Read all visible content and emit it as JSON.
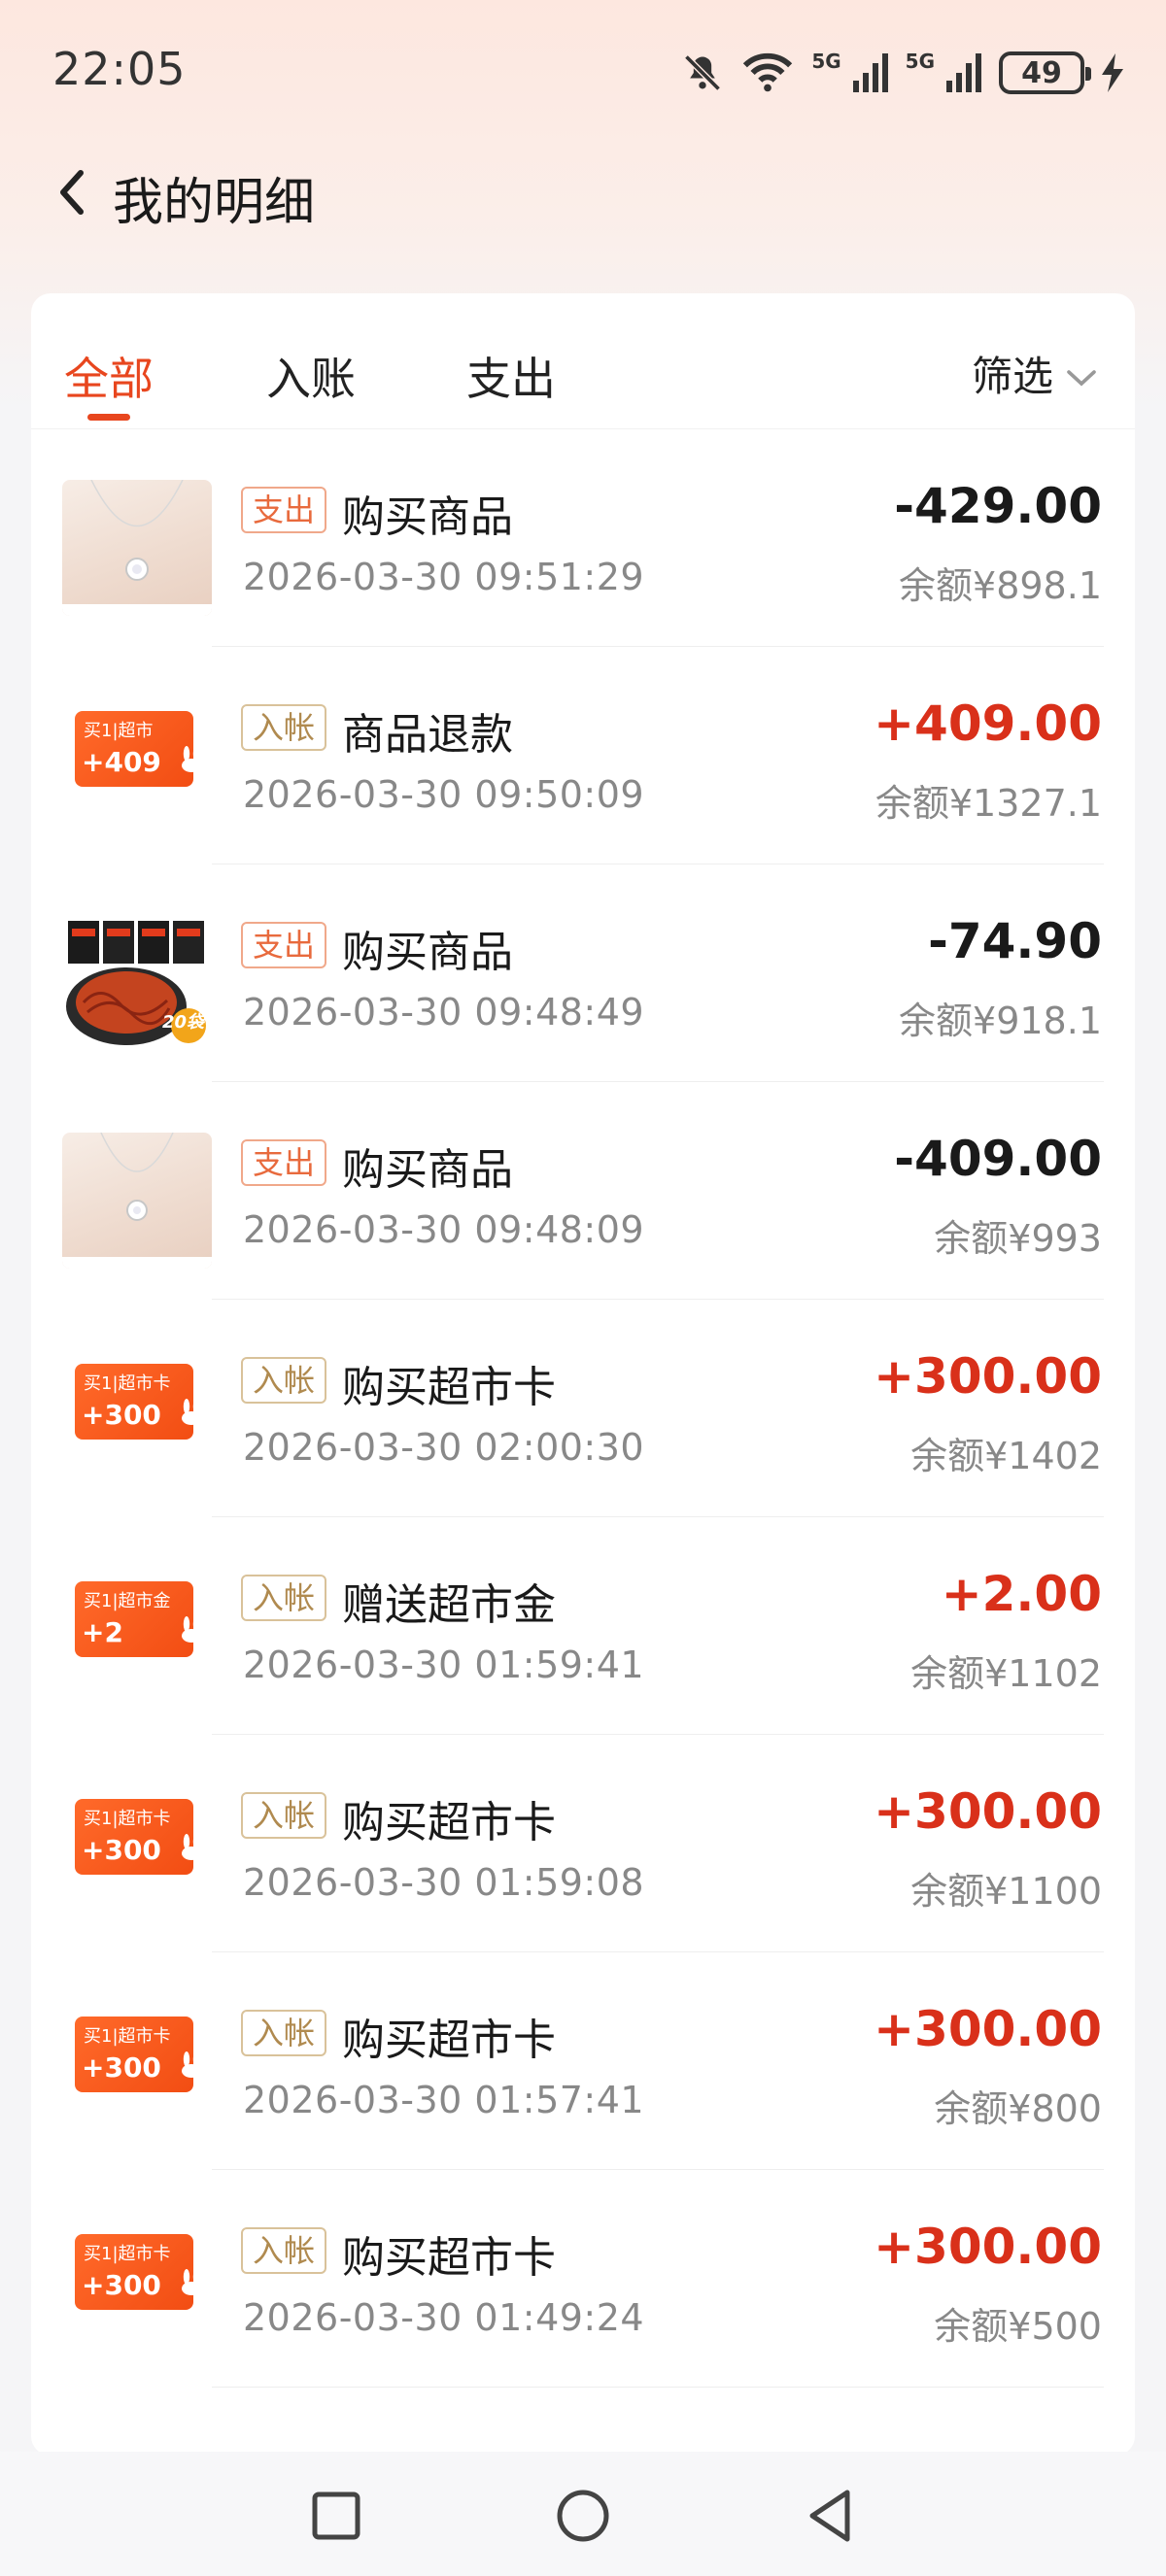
{
  "status_bar": {
    "time": "22:05",
    "network_1": "5G",
    "network_2": "5G",
    "battery": "49",
    "icons": [
      "bell-muted-icon",
      "wifi-icon",
      "signal-icon",
      "signal-icon",
      "battery-icon",
      "charging-icon"
    ]
  },
  "nav": {
    "title": "我的明细",
    "back_icon": "chevron-left-icon"
  },
  "tabs": {
    "items": [
      {
        "label": "全部",
        "active": true
      },
      {
        "label": "入账",
        "active": false
      },
      {
        "label": "支出",
        "active": false
      }
    ],
    "filter_label": "筛选",
    "filter_icon": "chevron-down-icon"
  },
  "transactions": [
    {
      "badge": "支出",
      "title": "购买商品",
      "time": "2026-03-30 09:51:29",
      "amount": "-429.00",
      "balance": "余额¥898.1",
      "thumb": "necklace-product-image"
    },
    {
      "badge": "入帐",
      "title": "商品退款",
      "time": "2026-03-30 09:50:09",
      "amount": "+409.00",
      "balance": "余额¥1327.1",
      "thumb": "card-thumbnail",
      "card_top": "买1|超市",
      "card_amount": "+409"
    },
    {
      "badge": "支出",
      "title": "购买商品",
      "time": "2026-03-30 09:48:49",
      "amount": "-74.90",
      "balance": "余额¥918.1",
      "thumb": "noodle-product-image",
      "thumb_label": "20袋"
    },
    {
      "badge": "支出",
      "title": "购买商品",
      "time": "2026-03-30 09:48:09",
      "amount": "-409.00",
      "balance": "余额¥993",
      "thumb": "necklace-product-image"
    },
    {
      "badge": "入帐",
      "title": "购买超市卡",
      "time": "2026-03-30 02:00:30",
      "amount": "+300.00",
      "balance": "余额¥1402",
      "thumb": "card-thumbnail",
      "card_top": "买1|超市卡",
      "card_amount": "+300"
    },
    {
      "badge": "入帐",
      "title": "赠送超市金",
      "time": "2026-03-30 01:59:41",
      "amount": "+2.00",
      "balance": "余额¥1102",
      "thumb": "card-thumbnail",
      "card_top": "买1|超市金",
      "card_amount": "+2"
    },
    {
      "badge": "入帐",
      "title": "购买超市卡",
      "time": "2026-03-30 01:59:08",
      "amount": "+300.00",
      "balance": "余额¥1100",
      "thumb": "card-thumbnail",
      "card_top": "买1|超市卡",
      "card_amount": "+300"
    },
    {
      "badge": "入帐",
      "title": "购买超市卡",
      "time": "2026-03-30 01:57:41",
      "amount": "+300.00",
      "balance": "余额¥800",
      "thumb": "card-thumbnail",
      "card_top": "买1|超市卡",
      "card_amount": "+300"
    },
    {
      "badge": "入帐",
      "title": "购买超市卡",
      "time": "2026-03-30 01:49:24",
      "amount": "+300.00",
      "balance": "余额¥500",
      "thumb": "card-thumbnail",
      "card_top": "买1|超市卡",
      "card_amount": "+300"
    }
  ],
  "colors": {
    "accent": "#e8461e",
    "income_amount": "#d9301a",
    "expense_badge": "#e86a3d",
    "income_badge": "#b08a4f",
    "card_orange": "#f4561a"
  },
  "bottom_nav": {
    "icons": [
      "recent-apps-square-icon",
      "home-circle-icon",
      "back-triangle-icon"
    ]
  }
}
